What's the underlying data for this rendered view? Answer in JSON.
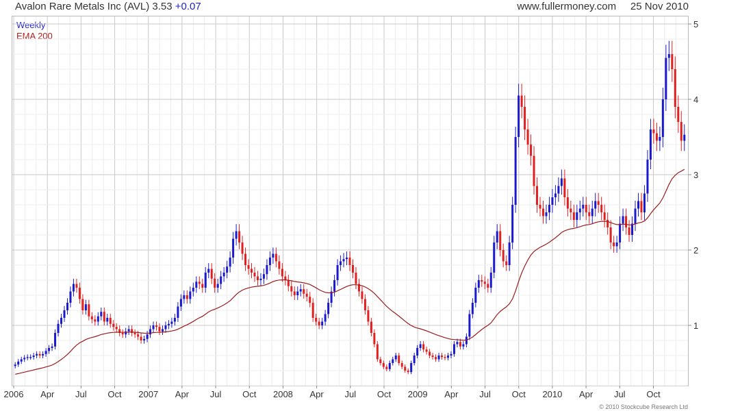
{
  "header": {
    "symbol_text": "Avalon Rare Metals Inc (AVL) 3.53",
    "change_text": "+0.07",
    "site": "www.fullermoney.com",
    "date": "25 Nov 2010"
  },
  "legend": {
    "period": "Weekly",
    "ema_label": "EMA 200"
  },
  "copyright": "© 2010 Stockcube Research Ltd",
  "chart_data": {
    "type": "candlestick",
    "period": "weekly",
    "ylim": [
      0.2,
      5.1
    ],
    "yticks": [
      1,
      2,
      3,
      4,
      5
    ],
    "x_range_months": [
      0,
      59.9
    ],
    "xticks": [
      {
        "label": "2006",
        "month": 0
      },
      {
        "label": "Apr",
        "month": 3
      },
      {
        "label": "Jul",
        "month": 6
      },
      {
        "label": "Oct",
        "month": 9
      },
      {
        "label": "2007",
        "month": 12
      },
      {
        "label": "Apr",
        "month": 15
      },
      {
        "label": "Jul",
        "month": 18
      },
      {
        "label": "Oct",
        "month": 21
      },
      {
        "label": "2008",
        "month": 24
      },
      {
        "label": "Apr",
        "month": 27
      },
      {
        "label": "Jul",
        "month": 30
      },
      {
        "label": "Oct",
        "month": 33
      },
      {
        "label": "2009",
        "month": 36
      },
      {
        "label": "Apr",
        "month": 39
      },
      {
        "label": "Jul",
        "month": 42
      },
      {
        "label": "Oct",
        "month": 45
      },
      {
        "label": "2010",
        "month": 48
      },
      {
        "label": "Apr",
        "month": 51
      },
      {
        "label": "Jul",
        "month": 54
      },
      {
        "label": "Oct",
        "month": 57
      }
    ],
    "colors": {
      "up": "#1a1acc",
      "down": "#e02020",
      "ema": "#9b1c1c",
      "grid": "#cfcfcf"
    },
    "close": [
      0.48,
      0.52,
      0.55,
      0.57,
      0.58,
      0.58,
      0.6,
      0.62,
      0.6,
      0.62,
      0.66,
      0.7,
      0.72,
      0.9,
      1.02,
      1.1,
      1.2,
      1.3,
      1.45,
      1.55,
      1.5,
      1.35,
      1.2,
      1.28,
      1.12,
      1.08,
      1.05,
      1.12,
      1.18,
      1.05,
      1.1,
      1.02,
      0.98,
      0.95,
      0.9,
      0.88,
      0.92,
      0.95,
      0.9,
      0.88,
      0.85,
      0.8,
      0.82,
      0.88,
      0.95,
      1.0,
      0.98,
      0.92,
      0.95,
      1.0,
      1.02,
      1.05,
      1.1,
      1.25,
      1.35,
      1.4,
      1.35,
      1.45,
      1.5,
      1.58,
      1.55,
      1.5,
      1.7,
      1.75,
      1.62,
      1.5,
      1.55,
      1.65,
      1.7,
      1.78,
      1.9,
      2.15,
      2.25,
      2.1,
      1.95,
      1.8,
      1.75,
      1.7,
      1.65,
      1.6,
      1.62,
      1.68,
      1.8,
      1.9,
      1.95,
      1.85,
      1.75,
      1.65,
      1.6,
      1.52,
      1.45,
      1.4,
      1.45,
      1.48,
      1.42,
      1.38,
      1.3,
      1.1,
      1.05,
      1.0,
      1.05,
      1.15,
      1.3,
      1.45,
      1.6,
      1.8,
      1.85,
      1.88,
      1.9,
      1.8,
      1.7,
      1.55,
      1.45,
      1.35,
      1.2,
      1.05,
      0.9,
      0.75,
      0.55,
      0.5,
      0.45,
      0.42,
      0.5,
      0.55,
      0.6,
      0.5,
      0.45,
      0.4,
      0.38,
      0.5,
      0.6,
      0.7,
      0.75,
      0.68,
      0.65,
      0.6,
      0.58,
      0.55,
      0.6,
      0.58,
      0.57,
      0.6,
      0.62,
      0.75,
      0.78,
      0.72,
      0.75,
      0.85,
      1.15,
      1.3,
      1.5,
      1.6,
      1.58,
      1.55,
      1.5,
      1.7,
      2.1,
      2.25,
      2.0,
      1.85,
      1.8,
      2.1,
      2.6,
      3.5,
      4.05,
      3.9,
      3.6,
      3.4,
      3.25,
      2.85,
      2.6,
      2.55,
      2.45,
      2.5,
      2.6,
      2.7,
      2.75,
      2.85,
      2.95,
      2.7,
      2.55,
      2.5,
      2.4,
      2.5,
      2.55,
      2.6,
      2.5,
      2.45,
      2.55,
      2.65,
      2.6,
      2.5,
      2.4,
      2.3,
      2.1,
      2.05,
      2.1,
      2.35,
      2.45,
      2.3,
      2.2,
      2.35,
      2.55,
      2.65,
      2.5,
      2.75,
      3.2,
      3.6,
      3.55,
      3.45,
      3.5,
      4.0,
      4.55,
      4.6,
      4.4,
      3.9,
      3.7,
      3.45,
      3.53
    ]
  }
}
